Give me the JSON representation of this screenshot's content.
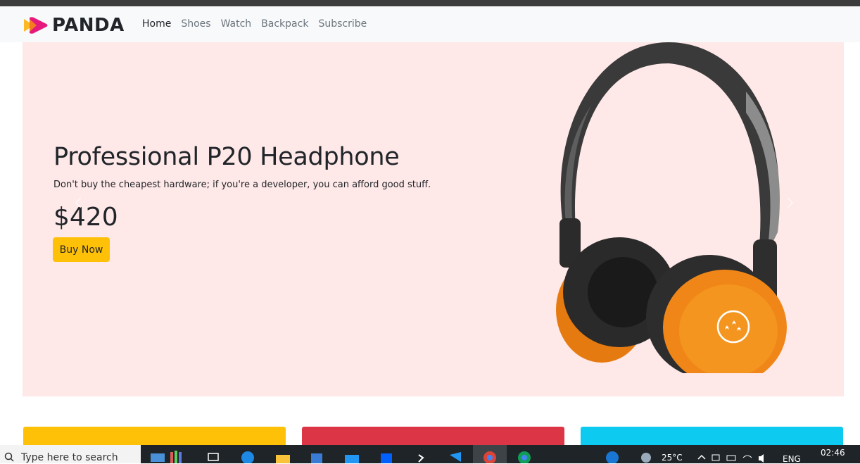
{
  "brand": {
    "name": "PANDA"
  },
  "nav": {
    "items": [
      {
        "label": "Home",
        "active": true
      },
      {
        "label": "Shoes",
        "active": false
      },
      {
        "label": "Watch",
        "active": false
      },
      {
        "label": "Backpack",
        "active": false
      },
      {
        "label": "Subscribe",
        "active": false
      }
    ]
  },
  "hero": {
    "title": "Professional P20 Headphone",
    "description": "Don't buy the cheapest hardware; if you're a developer, you can afford good stuff.",
    "price": "$420",
    "buy_label": "Buy Now",
    "image_icon": "headphone-image"
  },
  "cards": [
    {
      "color": "#ffc107"
    },
    {
      "color": "#dc3545"
    },
    {
      "color": "#0dcaf0"
    }
  ],
  "taskbar": {
    "search_placeholder": "Type here to search",
    "weather": "25°C",
    "language": "ENG",
    "time": "02:46"
  },
  "colors": {
    "hero_bg": "#fee8e8",
    "accent": "#ffc107",
    "logo_pink": "#e6197d",
    "logo_orange": "#fdb825"
  }
}
